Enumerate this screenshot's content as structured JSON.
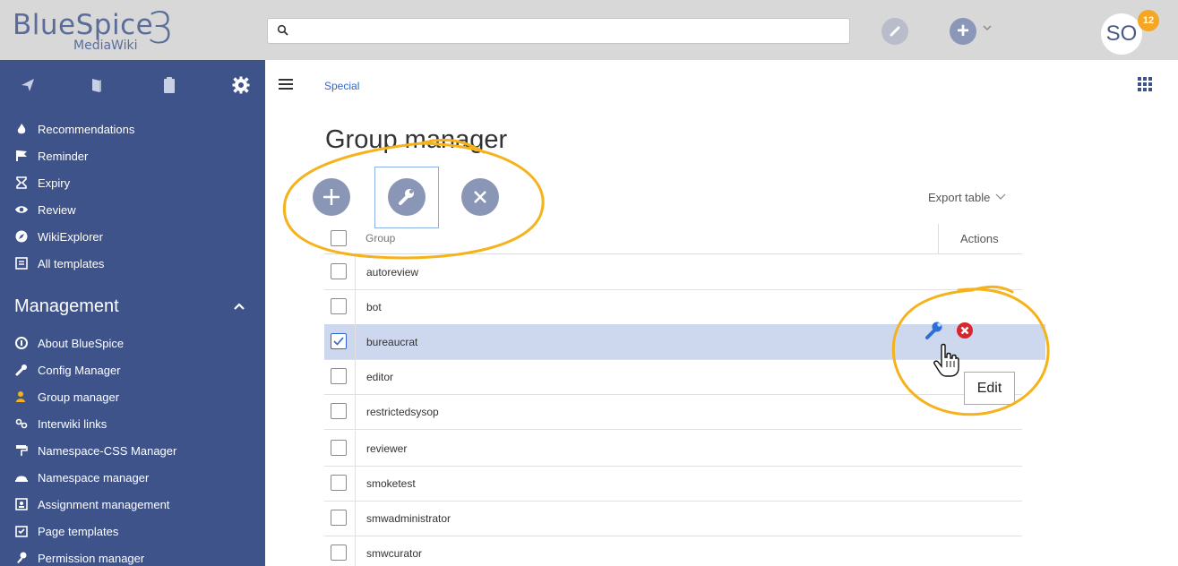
{
  "header": {
    "logo_main": "BlueSpice",
    "logo_sub": "MediaWiki",
    "logo_number": "3",
    "user_initials": "SO",
    "notification_count": "12"
  },
  "sidebar": {
    "tabs": [
      "navigation-icon",
      "book-icon",
      "clipboard-icon",
      "gear-icon"
    ],
    "top_items": [
      {
        "label": "Recommendations",
        "icon": "fire-icon"
      },
      {
        "label": "Reminder",
        "icon": "flag-icon"
      },
      {
        "label": "Expiry",
        "icon": "hourglass-icon"
      },
      {
        "label": "Review",
        "icon": "eye-icon"
      },
      {
        "label": "WikiExplorer",
        "icon": "compass-icon"
      },
      {
        "label": "All templates",
        "icon": "template-icon"
      }
    ],
    "management_title": "Management",
    "management_items": [
      {
        "label": "About BlueSpice",
        "icon": "info-icon"
      },
      {
        "label": "Config Manager",
        "icon": "wrench-icon"
      },
      {
        "label": "Group manager",
        "icon": "users-icon"
      },
      {
        "label": "Interwiki links",
        "icon": "link-icon"
      },
      {
        "label": "Namespace-CSS Manager",
        "icon": "paint-roller-icon"
      },
      {
        "label": "Namespace manager",
        "icon": "namespace-icon"
      },
      {
        "label": "Assignment management",
        "icon": "assignment-icon"
      },
      {
        "label": "Page templates",
        "icon": "page-template-icon"
      },
      {
        "label": "Permission manager",
        "icon": "key-icon"
      }
    ]
  },
  "main": {
    "breadcrumb": "Special",
    "title": "Group manager",
    "export_label": "Export table",
    "table": {
      "col_group": "Group",
      "col_actions": "Actions",
      "rows": [
        {
          "name": "autoreview",
          "checked": false
        },
        {
          "name": "bot",
          "checked": false
        },
        {
          "name": "bureaucrat",
          "checked": true
        },
        {
          "name": "editor",
          "checked": false
        },
        {
          "name": "restrictedsysop",
          "checked": false
        },
        {
          "name": "reviewer",
          "checked": false
        },
        {
          "name": "smoketest",
          "checked": false
        },
        {
          "name": "smwadministrator",
          "checked": false
        },
        {
          "name": "smwcurator",
          "checked": false
        }
      ]
    },
    "tooltip": "Edit"
  },
  "colors": {
    "sidebar_bg": "#3e5389",
    "accent": "#3366cc",
    "highlight_ring": "#f5b21b",
    "selected_row": "#cdd8ee",
    "delete_red": "#d9262c"
  }
}
